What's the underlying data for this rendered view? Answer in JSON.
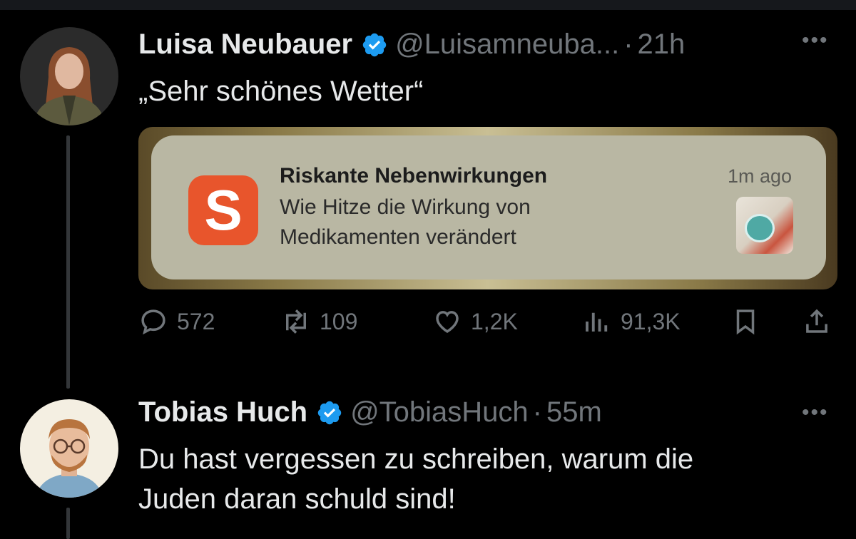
{
  "tweets": [
    {
      "name": "Luisa Neubauer",
      "handle": "@Luisamneuba...",
      "separator": "·",
      "time": "21h",
      "text": "„Sehr schönes Wetter“",
      "media": {
        "notification_icon_letter": "S",
        "notification_title": "Riskante Nebenwirkungen",
        "notification_body": "Wie Hitze die Wirkung von Medikamenten verändert",
        "notification_time": "1m ago"
      },
      "actions": {
        "replies": "572",
        "reposts": "109",
        "likes": "1,2K",
        "views": "91,3K"
      }
    },
    {
      "name": "Tobias Huch",
      "handle": "@TobiasHuch",
      "separator": "·",
      "time": "55m",
      "text_line1": "Du hast vergessen zu schreiben, warum die",
      "text_line2": "Juden daran schuld sind!"
    }
  ],
  "colors": {
    "background": "#000000",
    "primary_text": "#e7e9ea",
    "secondary_text": "#71767b",
    "verified_blue": "#1d9bf0",
    "notification_accent": "#e8552c"
  },
  "icons": [
    "verified-badge-icon",
    "more-icon",
    "reply-icon",
    "repost-icon",
    "like-icon",
    "views-icon",
    "bookmark-icon",
    "share-icon"
  ]
}
